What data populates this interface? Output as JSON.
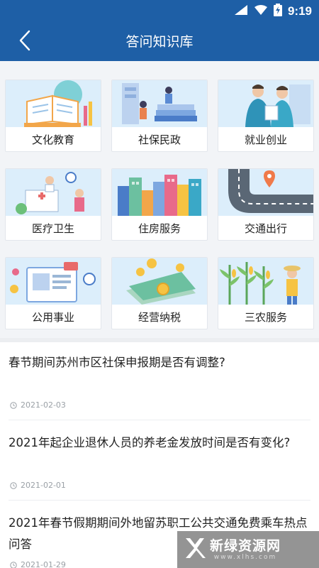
{
  "status_bar": {
    "time": "9:19"
  },
  "header": {
    "title": "答问知识库"
  },
  "categories": [
    {
      "label": "文化教育"
    },
    {
      "label": "社保民政"
    },
    {
      "label": "就业创业"
    },
    {
      "label": "医疗卫生"
    },
    {
      "label": "住房服务"
    },
    {
      "label": "交通出行"
    },
    {
      "label": "公用事业"
    },
    {
      "label": "经营纳税"
    },
    {
      "label": "三农服务"
    }
  ],
  "articles": [
    {
      "title": "春节期间苏州市区社保申报期是否有调整?",
      "date": "2021-02-03"
    },
    {
      "title": "2021年起企业退休人员的养老金发放时间是否有变化?",
      "date": "2021-02-01"
    },
    {
      "title": "2021年春节假期期间外地留苏职工公共交通免费乘车热点问答",
      "date": "2021-01-29"
    }
  ],
  "watermark": {
    "text": "新绿资源网",
    "url": "www.xlhs.com"
  },
  "colors": {
    "brand": "#1e5fa6",
    "illustration_bg": "#dceefb",
    "meta": "#9aa0a6"
  }
}
